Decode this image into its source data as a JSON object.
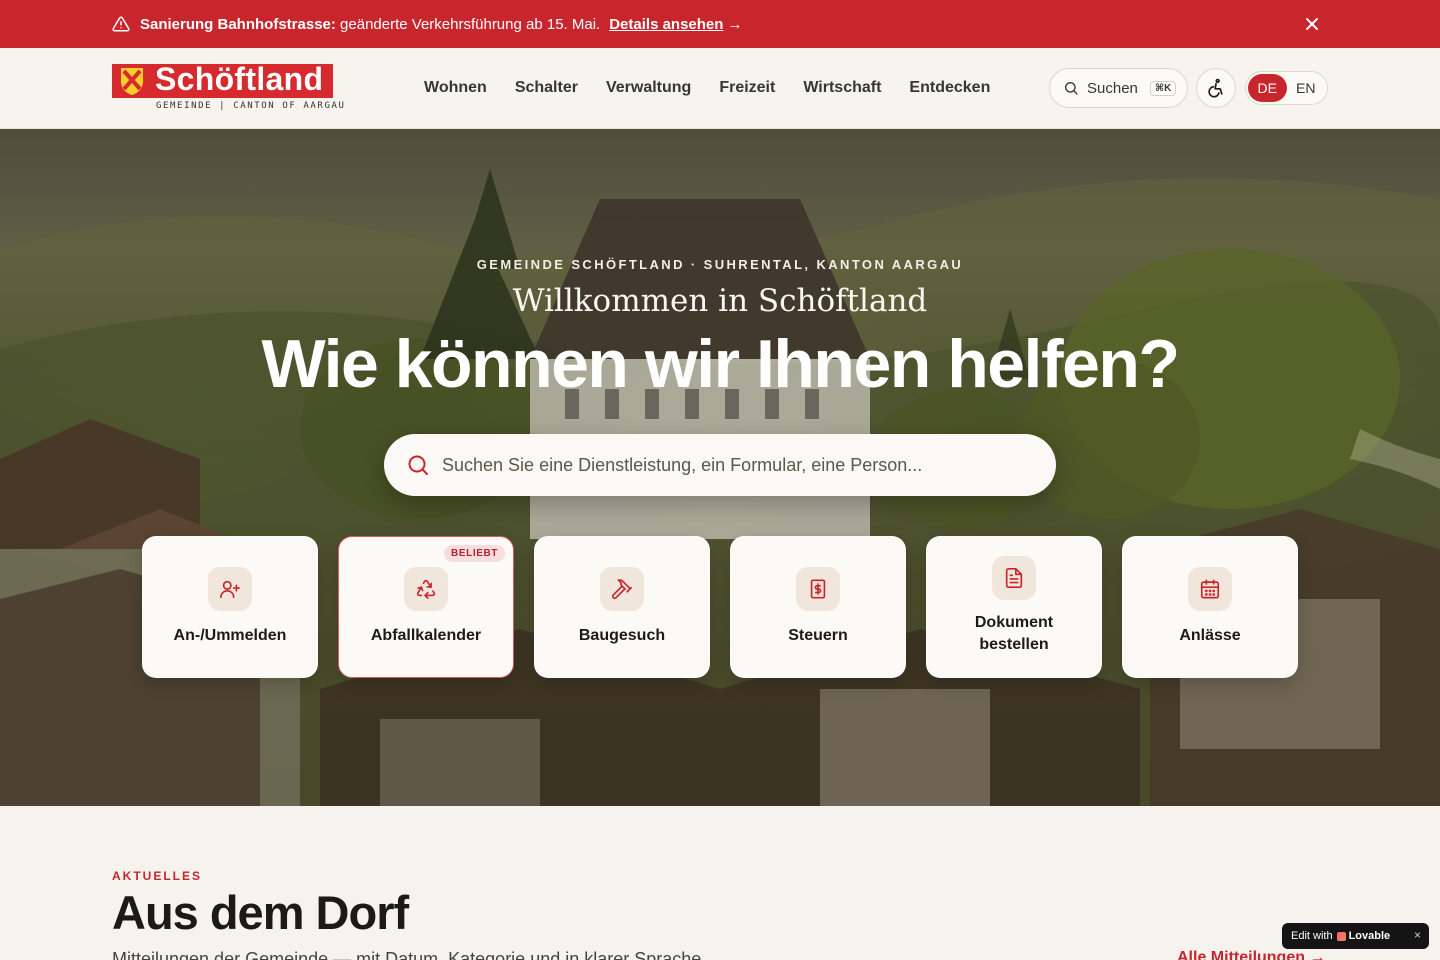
{
  "alert": {
    "title": "Sanierung Bahnhofstrasse:",
    "message": " geänderte Verkehrsführung ab 15. Mai.",
    "link": "Details ansehen",
    "arrow": "→",
    "close": "×",
    "color": "#c8252c"
  },
  "header": {
    "logo_name": "Schöftland",
    "logo_sub": "GEMEINDE | CANTON OF AARGAU",
    "nav": [
      "Wohnen",
      "Schalter",
      "Verwaltung",
      "Freizeit",
      "Wirtschaft",
      "Entdecken"
    ],
    "search_label": "Suchen",
    "search_kbd": "⌘K",
    "languages": [
      "DE",
      "EN"
    ],
    "active_language": "DE"
  },
  "hero": {
    "kicker": "GEMEINDE SCHÖFTLAND · SUHRENTAL, KANTON AARGAU",
    "welcome": "Willkommen in Schöftland",
    "headline": "Wie können wir Ihnen helfen?",
    "search_placeholder": "Suchen Sie eine Dienstleistung, ein Formular, eine Person..."
  },
  "quick_links": [
    {
      "label": "An-/Ummelden",
      "icon": "user-plus-icon"
    },
    {
      "label": "Abfallkalender",
      "icon": "recycle-icon",
      "badge": "BELIEBT"
    },
    {
      "label": "Baugesuch",
      "icon": "hammer-icon"
    },
    {
      "label": "Steuern",
      "icon": "receipt-icon"
    },
    {
      "label": "Dokument bestellen",
      "icon": "document-icon"
    },
    {
      "label": "Anlässe",
      "icon": "calendar-icon"
    }
  ],
  "news": {
    "kicker": "AKTUELLES",
    "title": "Aus dem Dorf",
    "subtitle": "Mitteilungen der Gemeinde — mit Datum, Kategorie und in klarer Sprache.",
    "all_link": "Alle Mitteilungen →"
  },
  "lovable": {
    "prefix": "Edit with",
    "brand": "Lovable",
    "close": "×"
  },
  "colors": {
    "accent": "#c8252c",
    "page_bg": "#f6f3ee",
    "card_icon_bg": "#f1e6dc"
  }
}
